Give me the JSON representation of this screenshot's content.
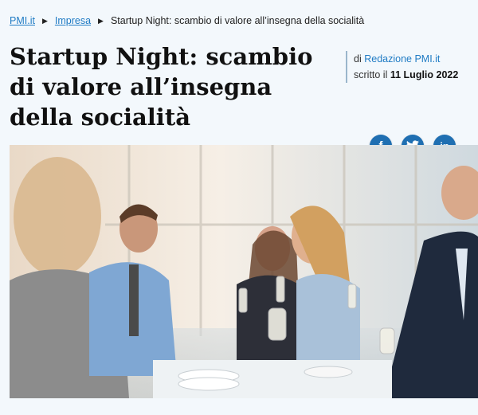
{
  "breadcrumb": {
    "home": "PMI.it",
    "section": "Impresa",
    "current": "Startup Night: scambio di valore all’insegna della socialità"
  },
  "article": {
    "title": "Startup Night: scambio di valore all’insegna della socialità",
    "author_prefix": "di",
    "author": "Redazione PMI.it",
    "date_prefix": "scritto il",
    "date": "11 Luglio 2022"
  },
  "social": [
    {
      "name": "facebook-icon",
      "glyph": "f"
    },
    {
      "name": "twitter-icon",
      "glyph": "t"
    },
    {
      "name": "linkedin-icon",
      "glyph": "in"
    }
  ],
  "colors": {
    "accent": "#1f7bc4",
    "social_button": "#1f6fb2",
    "background": "#f3f8fc"
  }
}
